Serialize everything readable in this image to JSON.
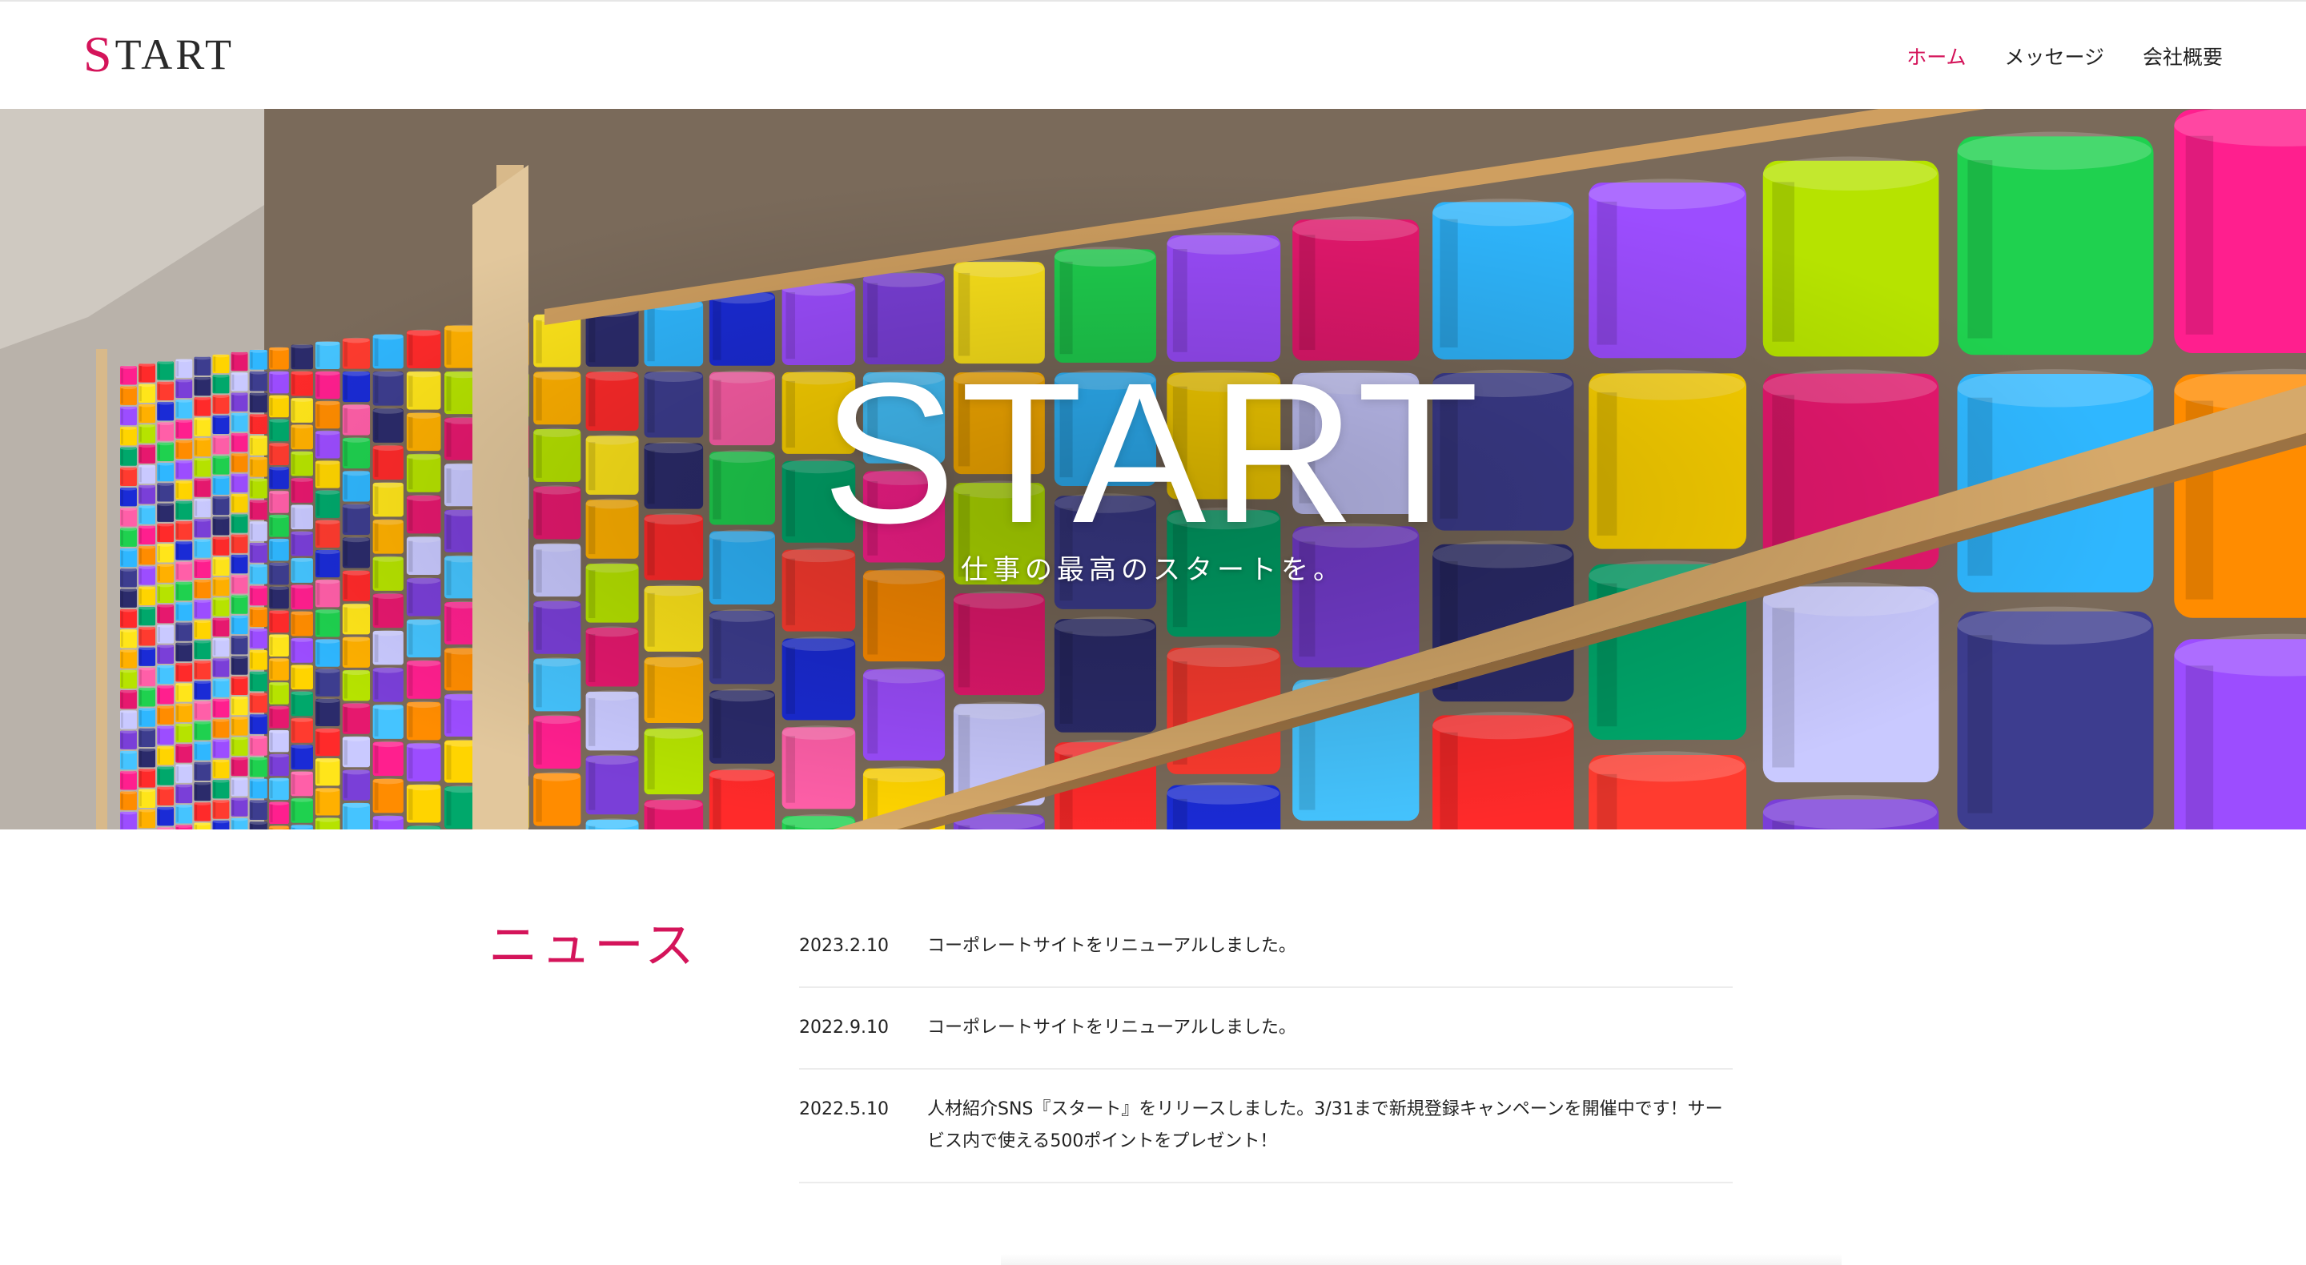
{
  "header": {
    "logo_initial": "S",
    "logo_rest": "TART",
    "nav": [
      {
        "label": "ホーム",
        "active": true
      },
      {
        "label": "メッセージ",
        "active": false
      },
      {
        "label": "会社概要",
        "active": false
      }
    ]
  },
  "hero": {
    "title": "START",
    "subtitle": "仕事の最高のスタートを。"
  },
  "news": {
    "heading": "ニュース",
    "items": [
      {
        "date": "2023.2.10",
        "text": "コーポレートサイトをリニューアルしました。"
      },
      {
        "date": "2022.9.10",
        "text": "コーポレートサイトをリニューアルしました。"
      },
      {
        "date": "2022.5.10",
        "text": "人材紹介SNS『スタート』をリリースしました。3/31まで新規登録キャンペーンを開催中です！サービス内で使える500ポイントをプレゼント！"
      }
    ]
  },
  "colors": {
    "accent": "#d4145a",
    "text": "#222222"
  }
}
